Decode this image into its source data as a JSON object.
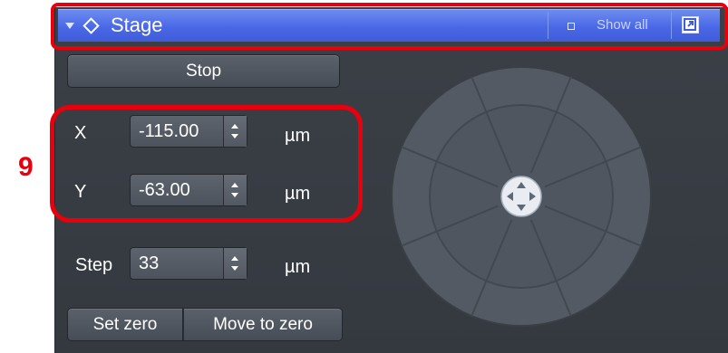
{
  "header": {
    "title": "Stage",
    "show_all_label": "Show all",
    "expanded_icon": "triangle-down-icon",
    "group_icon": "diamond-icon",
    "popout_icon": "popout-icon"
  },
  "controls": {
    "stop_label": "Stop",
    "x_label": "X",
    "x_value": "-115.00",
    "x_unit": "µm",
    "y_label": "Y",
    "y_value": "-63.00",
    "y_unit": "µm",
    "step_label": "Step",
    "step_value": "33",
    "step_unit": "µm",
    "set_zero_label": "Set zero",
    "move_to_zero_label": "Move to zero"
  },
  "annotation": {
    "marker": "9"
  },
  "colors": {
    "header_blue": "#4a68e6",
    "panel_bg": "#3b4047",
    "highlight_red": "#e8000d"
  }
}
